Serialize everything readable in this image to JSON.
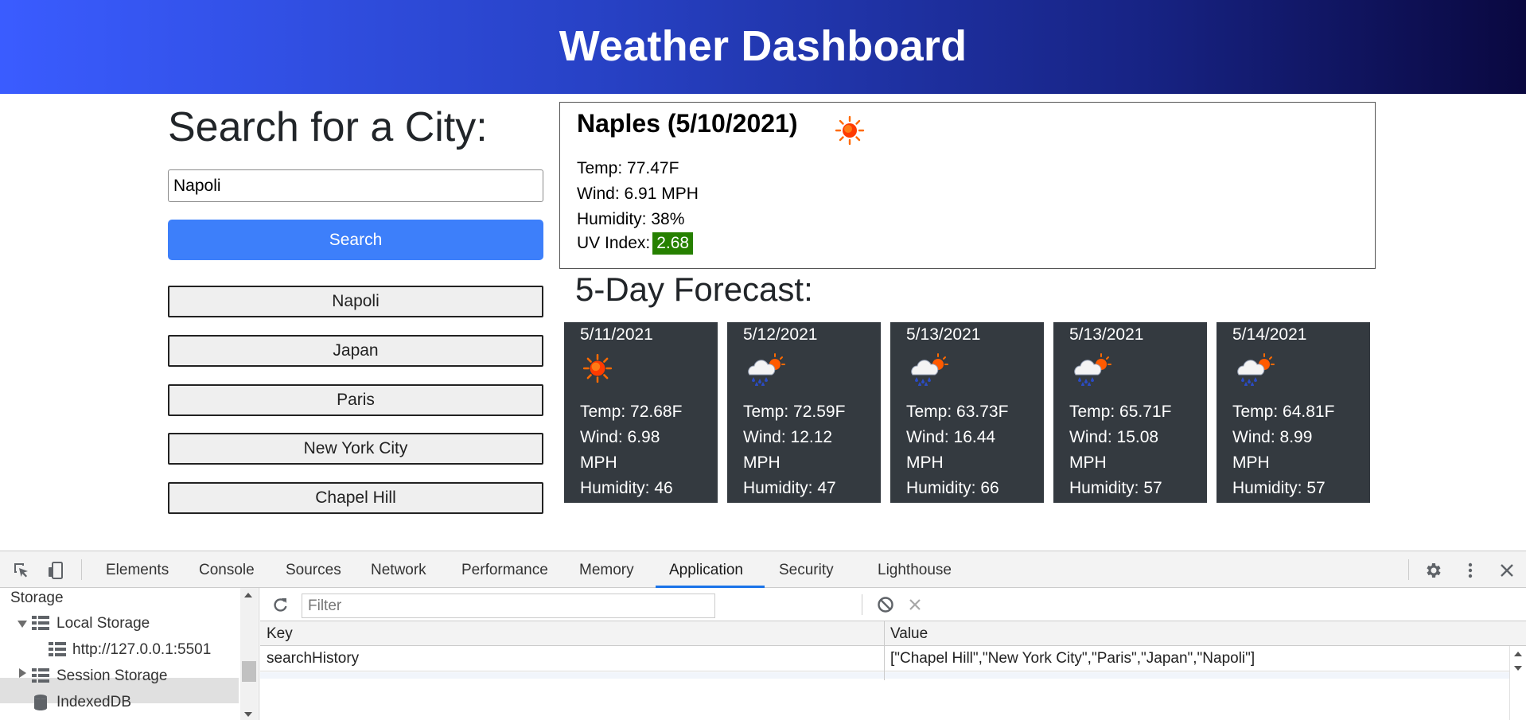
{
  "header": {
    "title": "Weather Dashboard"
  },
  "search": {
    "heading": "Search for a City:",
    "input_value": "Napoli",
    "button_label": "Search",
    "history": [
      "Napoli",
      "Japan",
      "Paris",
      "New York City",
      "Chapel Hill"
    ]
  },
  "current": {
    "title": "Naples (5/10/2021)",
    "icon": "sun-icon",
    "temp": "Temp: 77.47F",
    "wind": "Wind: 6.91 MPH",
    "humidity": "Humidity: 38%",
    "uv_label": "UV Index:",
    "uv_value": "2.68",
    "uv_color": "#268000"
  },
  "forecast": {
    "heading": "5-Day Forecast:",
    "days": [
      {
        "date": "5/11/2021",
        "icon": "sun-icon",
        "temp": "Temp: 72.68F",
        "wind": "Wind: 6.98",
        "wind_unit": "MPH",
        "humidity": "Humidity: 46"
      },
      {
        "date": "5/12/2021",
        "icon": "rain-sun-icon",
        "temp": "Temp: 72.59F",
        "wind": "Wind: 12.12",
        "wind_unit": "MPH",
        "humidity": "Humidity: 47"
      },
      {
        "date": "5/13/2021",
        "icon": "rain-sun-icon",
        "temp": "Temp: 63.73F",
        "wind": "Wind: 16.44",
        "wind_unit": "MPH",
        "humidity": "Humidity: 66"
      },
      {
        "date": "5/13/2021",
        "icon": "rain-sun-icon",
        "temp": "Temp: 65.71F",
        "wind": "Wind: 15.08",
        "wind_unit": "MPH",
        "humidity": "Humidity: 57"
      },
      {
        "date": "5/14/2021",
        "icon": "rain-sun-icon",
        "temp": "Temp: 64.81F",
        "wind": "Wind: 8.99",
        "wind_unit": "MPH",
        "humidity": "Humidity: 57"
      }
    ]
  },
  "devtools": {
    "tabs": [
      "Elements",
      "Console",
      "Sources",
      "Network",
      "Performance",
      "Memory",
      "Application",
      "Security",
      "Lighthouse"
    ],
    "active_tab": "Application",
    "sidebar": {
      "section": "Storage",
      "local_storage": "Local Storage",
      "origin": "http://127.0.0.1:5501",
      "session_storage": "Session Storage",
      "indexeddb": "IndexedDB"
    },
    "filter_placeholder": "Filter",
    "table": {
      "headers": [
        "Key",
        "Value"
      ],
      "rows": [
        {
          "key": "searchHistory",
          "value": "[\"Chapel Hill\",\"New York City\",\"Paris\",\"Japan\",\"Napoli\"]"
        }
      ]
    }
  }
}
